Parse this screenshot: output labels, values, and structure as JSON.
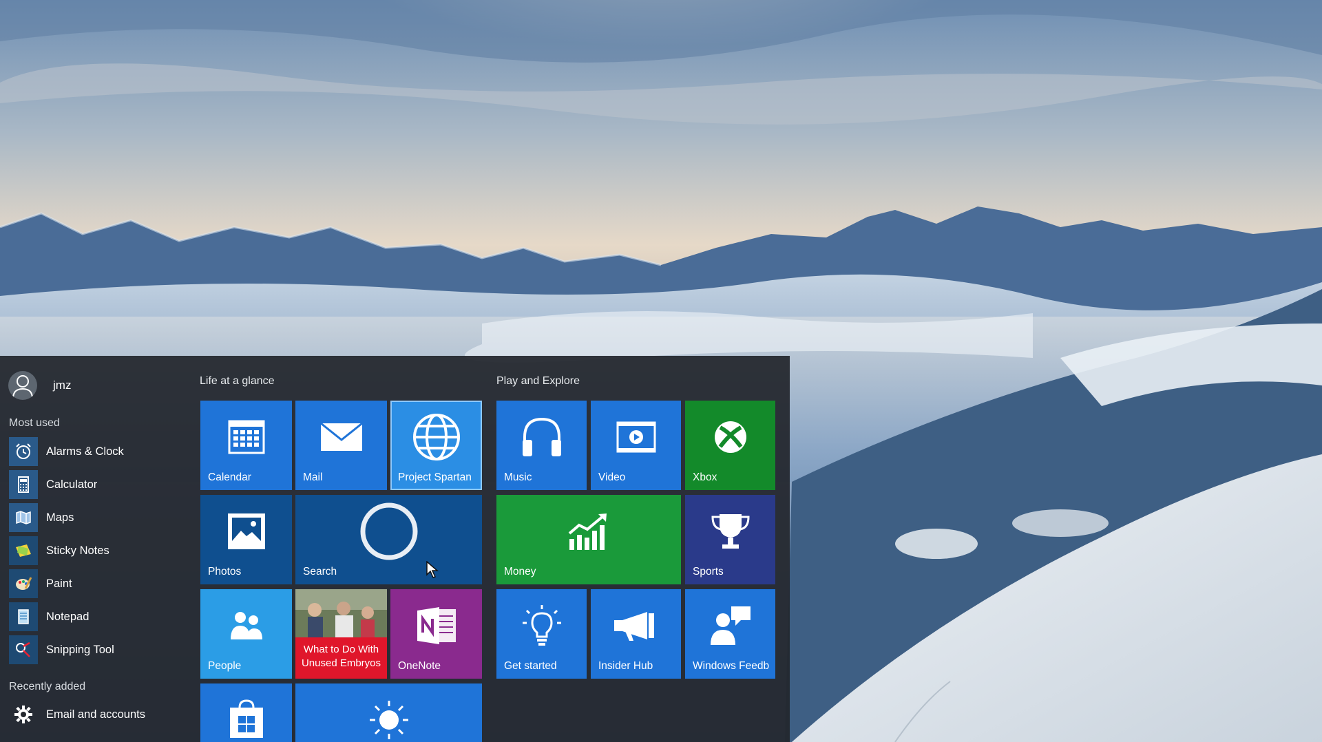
{
  "user": {
    "name": "jmz"
  },
  "sections": {
    "most_used": "Most used",
    "recently_added": "Recently added"
  },
  "most_used": [
    {
      "label": "Alarms & Clock",
      "icon": "alarm-clock-icon"
    },
    {
      "label": "Calculator",
      "icon": "calculator-icon"
    },
    {
      "label": "Maps",
      "icon": "map-icon"
    },
    {
      "label": "Sticky Notes",
      "icon": "sticky-note-icon"
    },
    {
      "label": "Paint",
      "icon": "paint-palette-icon"
    },
    {
      "label": "Notepad",
      "icon": "notepad-icon"
    },
    {
      "label": "Snipping Tool",
      "icon": "scissors-icon"
    }
  ],
  "recently_added": [
    {
      "label": "Email and accounts",
      "icon": "gear-icon"
    }
  ],
  "groups": {
    "life": "Life at a glance",
    "play": "Play and Explore"
  },
  "tiles": {
    "calendar": {
      "label": "Calendar",
      "icon": "calendar-icon"
    },
    "mail": {
      "label": "Mail",
      "icon": "envelope-icon"
    },
    "spartan": {
      "label": "Project Spartan",
      "icon": "globe-icon"
    },
    "photos": {
      "label": "Photos",
      "icon": "photo-icon"
    },
    "search": {
      "label": "Search",
      "icon": "cortana-circle-icon"
    },
    "people": {
      "label": "People",
      "icon": "people-icon"
    },
    "news": {
      "headline": "What to Do With Unused Embryos",
      "icon": "news-photo"
    },
    "onenote": {
      "label": "OneNote",
      "icon": "onenote-icon"
    },
    "store": {
      "label": "",
      "icon": "store-bag-icon"
    },
    "weather": {
      "label": "",
      "icon": "sun-icon"
    },
    "music": {
      "label": "Music",
      "icon": "headphones-icon"
    },
    "video": {
      "label": "Video",
      "icon": "video-play-icon"
    },
    "xbox": {
      "label": "Xbox",
      "icon": "xbox-icon"
    },
    "money": {
      "label": "Money",
      "icon": "chart-up-icon"
    },
    "sports": {
      "label": "Sports",
      "icon": "trophy-icon"
    },
    "getstarted": {
      "label": "Get started",
      "icon": "lightbulb-icon"
    },
    "insider": {
      "label": "Insider Hub",
      "icon": "megaphone-icon"
    },
    "feedback": {
      "label": "Windows Feedb",
      "icon": "feedback-person-icon"
    }
  },
  "colors": {
    "tile_blue": "#1f74d8",
    "tile_dark_blue": "#0f4f8f",
    "tile_light_blue": "#2b9de6",
    "tile_green": "#1a9a3a",
    "tile_xbox_green": "#138a2a",
    "tile_purple": "#2a3a8a",
    "tile_onenote": "#8a2a8e",
    "tile_news_red": "#e0162b",
    "menu_bg": "#22262c"
  }
}
